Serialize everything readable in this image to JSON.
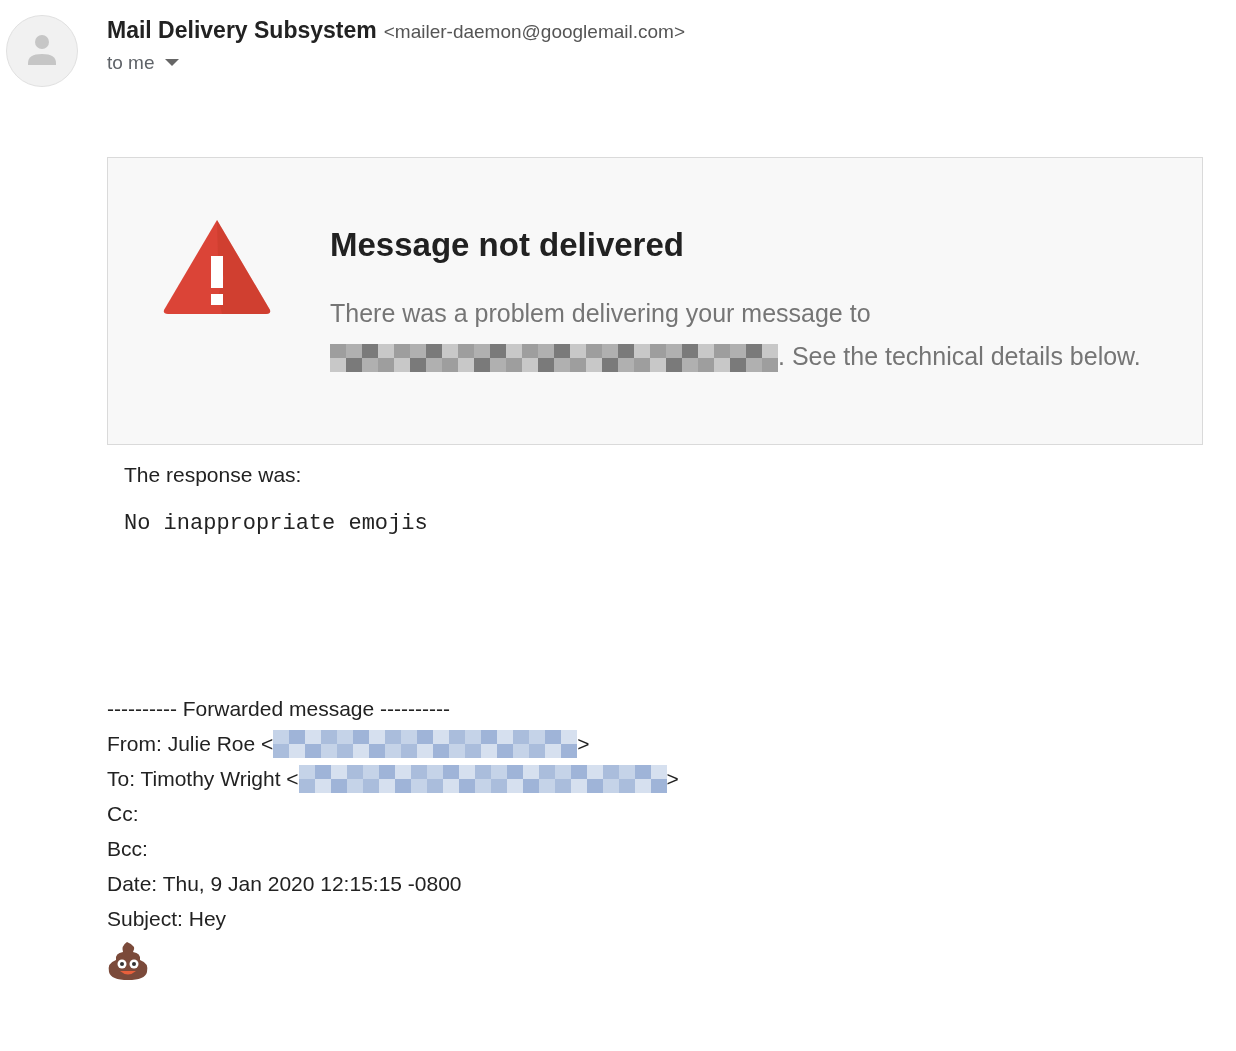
{
  "sender": {
    "name": "Mail Delivery Subsystem",
    "address": "<mailer-daemon@googlemail.com>",
    "recipient": "to me"
  },
  "notice": {
    "title": "Message not delivered",
    "text_before": "There was a problem delivering your message to",
    "text_after": ". See the technical details below."
  },
  "response": {
    "label": "The response was:",
    "message": "No inappropriate emojis"
  },
  "forwarded": {
    "separator": "---------- Forwarded message ----------",
    "fields": [
      {
        "text": "From: Julie Roe <",
        "redacted": true,
        "suffix": ">"
      },
      {
        "text": "To: Timothy Wright <",
        "redacted": true,
        "suffix": ">"
      },
      {
        "text": "Cc:",
        "redacted": false
      },
      {
        "text": "Bcc:",
        "redacted": false
      },
      {
        "text": "Date: Thu, 9 Jan 2020 12:15:15 -0800",
        "redacted": false
      },
      {
        "text": "Subject: Hey",
        "redacted": false
      }
    ]
  }
}
